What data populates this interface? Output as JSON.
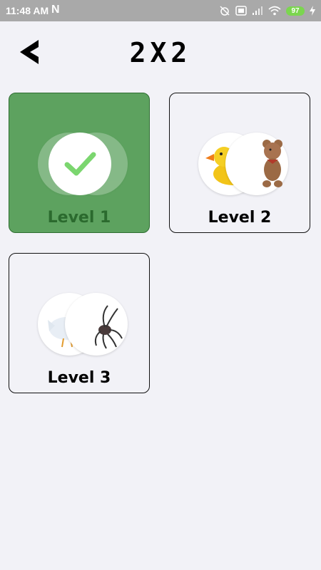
{
  "status_bar": {
    "time": "11:48 AM",
    "notif": "N",
    "battery": "97"
  },
  "header": {
    "title": "2X2"
  },
  "levels": [
    {
      "label": "Level 1",
      "completed": true
    },
    {
      "label": "Level 2",
      "completed": false,
      "images": [
        "duck-icon",
        "teddy-bear-icon"
      ]
    },
    {
      "label": "Level 3",
      "completed": false,
      "images": [
        "chicken-icon",
        "spider-icon"
      ]
    }
  ],
  "colors": {
    "completed_bg": "#5da25f",
    "check": "#7bd66f",
    "background": "#f2f2f7"
  }
}
